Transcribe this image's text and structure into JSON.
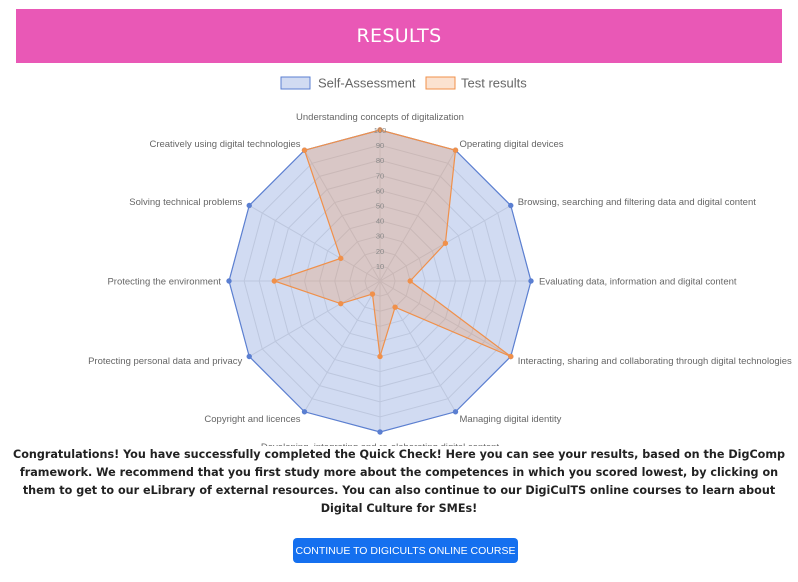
{
  "header": {
    "title": "RESULTS"
  },
  "chart_data": {
    "type": "radar",
    "labels": [
      "Understanding concepts of digitalization",
      "Operating digital devices",
      "Browsing, searching and filtering data and digital content",
      "Evaluating data, information and digital content",
      "Interacting, sharing and collaborating through digital technologies",
      "Managing digital identity",
      "Developing, integrating and re-elaborating digital content",
      "Copyright and licences",
      "Protecting personal data and privacy",
      "Protecting the environment",
      "Solving technical problems",
      "Creatively using digital technologies"
    ],
    "ticks": [
      "10",
      "20",
      "30",
      "40",
      "50",
      "60",
      "70",
      "80",
      "90",
      "100"
    ],
    "rmin": 0,
    "rmax": 100,
    "legend_position": "top",
    "series": [
      {
        "name": "Self-Assessment",
        "values": [
          100,
          100,
          100,
          100,
          100,
          100,
          100,
          100,
          100,
          100,
          100,
          100
        ],
        "color": "#5b7fd1",
        "fill": "rgba(91,127,209,0.28)"
      },
      {
        "name": "Test results",
        "values": [
          100,
          100,
          50,
          20,
          100,
          20,
          50,
          10,
          30,
          70,
          30,
          100
        ],
        "color": "#f0904a",
        "fill": "rgba(240,144,74,0.26)"
      }
    ]
  },
  "message": "Congratulations! You have successfully completed the Quick Check! Here you can see your results, based on the DigComp framework. We recommend that you first study more about the competences in which you scored lowest, by clicking on them to get to our eLibrary of external resources. You can also continue to our DigiCulTS online courses to learn about Digital Culture for SMEs!",
  "cta": {
    "label": "CONTINUE TO DIGICULTS ONLINE COURSE"
  }
}
